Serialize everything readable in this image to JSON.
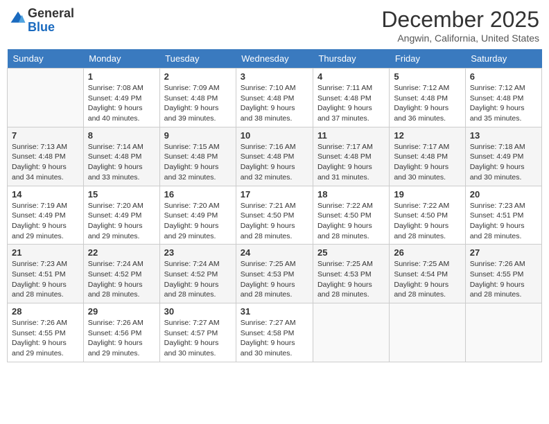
{
  "header": {
    "logo_general": "General",
    "logo_blue": "Blue",
    "month_title": "December 2025",
    "location": "Angwin, California, United States"
  },
  "days_of_week": [
    "Sunday",
    "Monday",
    "Tuesday",
    "Wednesday",
    "Thursday",
    "Friday",
    "Saturday"
  ],
  "weeks": [
    [
      {
        "day": "",
        "info": ""
      },
      {
        "day": "1",
        "info": "Sunrise: 7:08 AM\nSunset: 4:49 PM\nDaylight: 9 hours\nand 40 minutes."
      },
      {
        "day": "2",
        "info": "Sunrise: 7:09 AM\nSunset: 4:48 PM\nDaylight: 9 hours\nand 39 minutes."
      },
      {
        "day": "3",
        "info": "Sunrise: 7:10 AM\nSunset: 4:48 PM\nDaylight: 9 hours\nand 38 minutes."
      },
      {
        "day": "4",
        "info": "Sunrise: 7:11 AM\nSunset: 4:48 PM\nDaylight: 9 hours\nand 37 minutes."
      },
      {
        "day": "5",
        "info": "Sunrise: 7:12 AM\nSunset: 4:48 PM\nDaylight: 9 hours\nand 36 minutes."
      },
      {
        "day": "6",
        "info": "Sunrise: 7:12 AM\nSunset: 4:48 PM\nDaylight: 9 hours\nand 35 minutes."
      }
    ],
    [
      {
        "day": "7",
        "info": "Sunrise: 7:13 AM\nSunset: 4:48 PM\nDaylight: 9 hours\nand 34 minutes."
      },
      {
        "day": "8",
        "info": "Sunrise: 7:14 AM\nSunset: 4:48 PM\nDaylight: 9 hours\nand 33 minutes."
      },
      {
        "day": "9",
        "info": "Sunrise: 7:15 AM\nSunset: 4:48 PM\nDaylight: 9 hours\nand 32 minutes."
      },
      {
        "day": "10",
        "info": "Sunrise: 7:16 AM\nSunset: 4:48 PM\nDaylight: 9 hours\nand 32 minutes."
      },
      {
        "day": "11",
        "info": "Sunrise: 7:17 AM\nSunset: 4:48 PM\nDaylight: 9 hours\nand 31 minutes."
      },
      {
        "day": "12",
        "info": "Sunrise: 7:17 AM\nSunset: 4:48 PM\nDaylight: 9 hours\nand 30 minutes."
      },
      {
        "day": "13",
        "info": "Sunrise: 7:18 AM\nSunset: 4:49 PM\nDaylight: 9 hours\nand 30 minutes."
      }
    ],
    [
      {
        "day": "14",
        "info": "Sunrise: 7:19 AM\nSunset: 4:49 PM\nDaylight: 9 hours\nand 29 minutes."
      },
      {
        "day": "15",
        "info": "Sunrise: 7:20 AM\nSunset: 4:49 PM\nDaylight: 9 hours\nand 29 minutes."
      },
      {
        "day": "16",
        "info": "Sunrise: 7:20 AM\nSunset: 4:49 PM\nDaylight: 9 hours\nand 29 minutes."
      },
      {
        "day": "17",
        "info": "Sunrise: 7:21 AM\nSunset: 4:50 PM\nDaylight: 9 hours\nand 28 minutes."
      },
      {
        "day": "18",
        "info": "Sunrise: 7:22 AM\nSunset: 4:50 PM\nDaylight: 9 hours\nand 28 minutes."
      },
      {
        "day": "19",
        "info": "Sunrise: 7:22 AM\nSunset: 4:50 PM\nDaylight: 9 hours\nand 28 minutes."
      },
      {
        "day": "20",
        "info": "Sunrise: 7:23 AM\nSunset: 4:51 PM\nDaylight: 9 hours\nand 28 minutes."
      }
    ],
    [
      {
        "day": "21",
        "info": "Sunrise: 7:23 AM\nSunset: 4:51 PM\nDaylight: 9 hours\nand 28 minutes."
      },
      {
        "day": "22",
        "info": "Sunrise: 7:24 AM\nSunset: 4:52 PM\nDaylight: 9 hours\nand 28 minutes."
      },
      {
        "day": "23",
        "info": "Sunrise: 7:24 AM\nSunset: 4:52 PM\nDaylight: 9 hours\nand 28 minutes."
      },
      {
        "day": "24",
        "info": "Sunrise: 7:25 AM\nSunset: 4:53 PM\nDaylight: 9 hours\nand 28 minutes."
      },
      {
        "day": "25",
        "info": "Sunrise: 7:25 AM\nSunset: 4:53 PM\nDaylight: 9 hours\nand 28 minutes."
      },
      {
        "day": "26",
        "info": "Sunrise: 7:25 AM\nSunset: 4:54 PM\nDaylight: 9 hours\nand 28 minutes."
      },
      {
        "day": "27",
        "info": "Sunrise: 7:26 AM\nSunset: 4:55 PM\nDaylight: 9 hours\nand 28 minutes."
      }
    ],
    [
      {
        "day": "28",
        "info": "Sunrise: 7:26 AM\nSunset: 4:55 PM\nDaylight: 9 hours\nand 29 minutes."
      },
      {
        "day": "29",
        "info": "Sunrise: 7:26 AM\nSunset: 4:56 PM\nDaylight: 9 hours\nand 29 minutes."
      },
      {
        "day": "30",
        "info": "Sunrise: 7:27 AM\nSunset: 4:57 PM\nDaylight: 9 hours\nand 30 minutes."
      },
      {
        "day": "31",
        "info": "Sunrise: 7:27 AM\nSunset: 4:58 PM\nDaylight: 9 hours\nand 30 minutes."
      },
      {
        "day": "",
        "info": ""
      },
      {
        "day": "",
        "info": ""
      },
      {
        "day": "",
        "info": ""
      }
    ]
  ]
}
